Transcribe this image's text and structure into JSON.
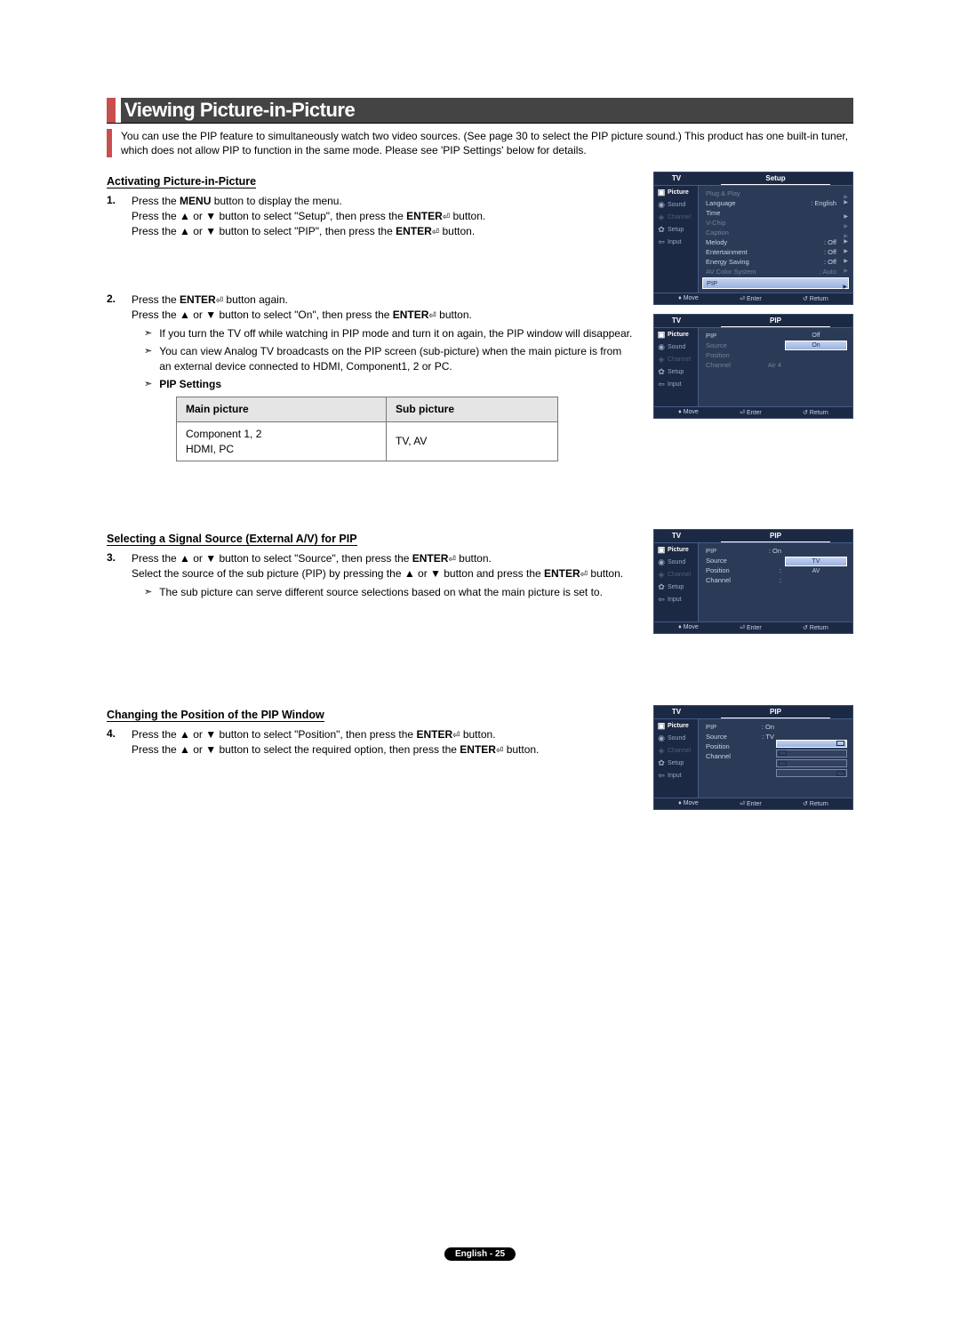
{
  "title": "Viewing Picture-in-Picture",
  "intro": "You can use the PIP feature to simultaneously watch two video sources. (See page 30 to select the PIP picture sound.) This product has one built-in tuner, which does not allow PIP to function in the same mode. Please see 'PIP Settings' below for details.",
  "section1": {
    "heading": "Activating Picture-in-Picture",
    "step1_num": "1.",
    "step1_l1_a": "Press the ",
    "step1_l1_b": "MENU",
    "step1_l1_c": " button to display the menu.",
    "step1_l2_a": "Press the ▲ or ▼ button to select \"Setup\", then press the ",
    "step1_l2_b": "ENTER",
    "step1_l2_c": " button.",
    "step1_l3_a": "Press the ▲ or ▼ button to select \"PIP\", then press the ",
    "step1_l3_b": "ENTER",
    "step1_l3_c": " button.",
    "step2_num": "2.",
    "step2_l1_a": "Press the ",
    "step2_l1_b": "ENTER",
    "step2_l1_c": " button again.",
    "step2_l2_a": "Press the ▲ or ▼ button to select \"On\", then press the ",
    "step2_l2_b": "ENTER",
    "step2_l2_c": " button.",
    "bullet_a": "If you turn the TV off while watching in PIP mode and turn it on again, the PIP window will disappear.",
    "bullet_b": "You can view Analog TV broadcasts on the PIP screen (sub-picture) when the main picture is from an external device connected to HDMI, Component1, 2 or PC.",
    "bullet_c": "PIP Settings",
    "table": {
      "h1": "Main picture",
      "h2": "Sub picture",
      "r1c1a": "Component 1, 2",
      "r1c1b": "HDMI, PC",
      "r1c2": "TV, AV"
    }
  },
  "section3": {
    "heading": "Selecting a Signal Source (External A/V) for PIP",
    "step3_num": "3.",
    "l1_a": "Press the ▲ or ▼ button to select \"Source\", then press the ",
    "l1_b": "ENTER",
    "l1_c": " button.",
    "l2_a": "Select the source of the sub picture (PIP) by pressing the ▲ or ▼ button and press the ",
    "l2_b": "ENTER",
    "l2_c": " button.",
    "bullet": "The sub picture can serve different source selections based on what the main picture is set to."
  },
  "section4": {
    "heading": "Changing the Position of the PIP Window",
    "step4_num": "4.",
    "l1_a": "Press the ▲ or ▼ button to select \"Position\", then press the ",
    "l1_b": "ENTER",
    "l1_c": " button.",
    "l2_a": "Press the ▲ or ▼ button to select the required option, then press the ",
    "l2_b": "ENTER",
    "l2_c": " button."
  },
  "osd": {
    "side": {
      "picture": "Picture",
      "sound": "Sound",
      "channel": "Channel",
      "setup": "Setup",
      "input": "Input"
    },
    "footer": {
      "move": "Move",
      "enter": "Enter",
      "return": "Return"
    },
    "setup": {
      "tv": "TV",
      "title": "Setup",
      "plug": "Plug & Play",
      "lang": "Language",
      "lang_v": ": English",
      "time": "Time",
      "mode": "V-Chip",
      "caption": "Caption",
      "melody": "Melody",
      "melody_v": ": Off",
      "ent": "Entertainment",
      "ent_v": ": Off",
      "energy": "Energy Saving",
      "energy_v": ": Off",
      "avcs": "AV Color System",
      "avcs_v": ": Auto",
      "pip": "PIP"
    },
    "pip1": {
      "tv": "TV",
      "title": "PIP",
      "pip": "PIP",
      "source": "Source",
      "position": "Position",
      "channel": "Channel",
      "channel_v": "Air     4",
      "off": "Off",
      "on": "On"
    },
    "pip2": {
      "tv": "TV",
      "title": "PIP",
      "pip": "PIP",
      "pip_v": ": On",
      "source": "Source",
      "position": "Position",
      "position_v": ":",
      "channel": "Channel",
      "channel_v": ":",
      "opt_tv": "TV",
      "opt_av": "AV"
    },
    "pip3": {
      "tv": "TV",
      "title": "PIP",
      "pip": "PIP",
      "pip_v": ": On",
      "source": "Source",
      "source_v": ": TV",
      "position": "Position",
      "channel": "Channel"
    }
  },
  "page_foot": "English - 25"
}
